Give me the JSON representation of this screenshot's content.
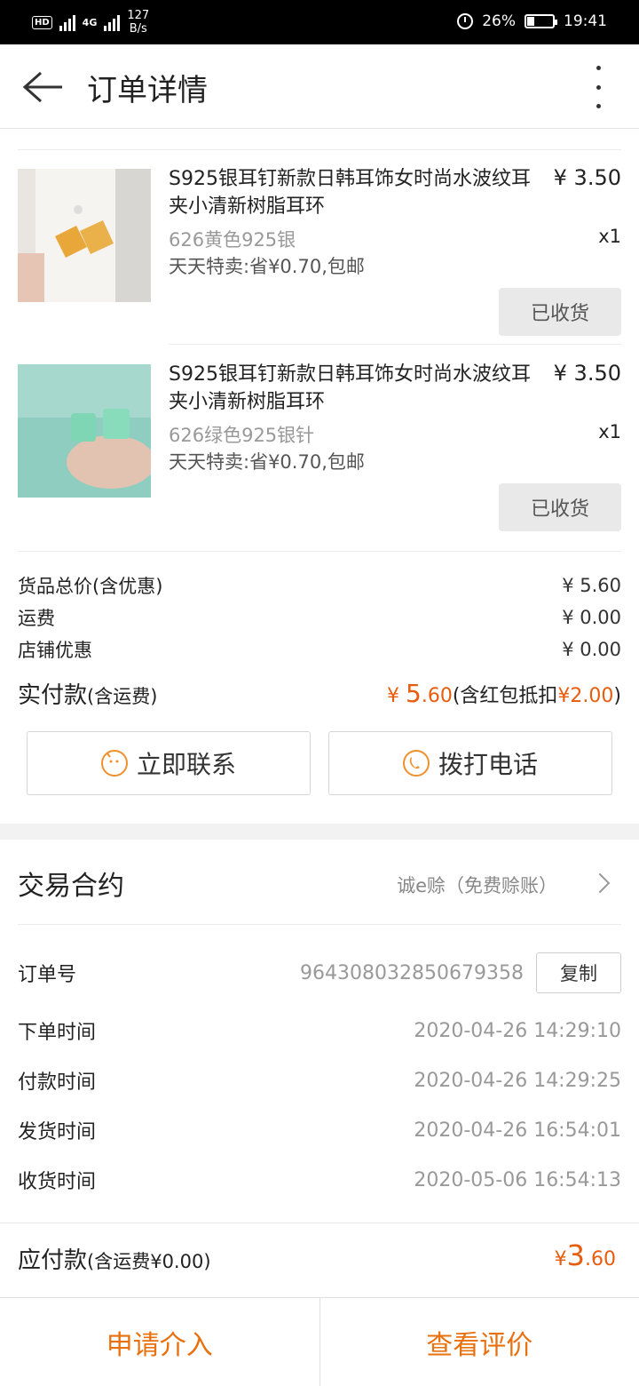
{
  "status_bar": {
    "hd": "HD",
    "network": "4G",
    "speed_value": "127",
    "speed_unit": "B/s",
    "battery_text": "26%",
    "battery_level": 0.26,
    "time": "19:41"
  },
  "header": {
    "title": "订单详情"
  },
  "products": [
    {
      "name": "S925银耳钉新款日韩耳饰女时尚水波纹耳夹小清新树脂耳环",
      "price": "¥ 3.50",
      "spec": "626黄色925银",
      "qty": "x1",
      "promo": "天天特卖:省¥0.70,包邮",
      "status_button": "已收货"
    },
    {
      "name": "S925银耳钉新款日韩耳饰女时尚水波纹耳夹小清新树脂耳环",
      "price": "¥ 3.50",
      "spec": "626绿色925银针",
      "qty": "x1",
      "promo": "天天特卖:省¥0.70,包邮",
      "status_button": "已收货"
    }
  ],
  "summary": {
    "goods_total_label": "货品总价(含优惠)",
    "goods_total_value": "¥ 5.60",
    "shipping_label": "运费",
    "shipping_value": "¥ 0.00",
    "store_discount_label": "店铺优惠",
    "store_discount_value": "¥ 0.00",
    "paid_label": "实付款",
    "paid_label_note": "(含运费)",
    "paid_currency": "¥ ",
    "paid_int": "5",
    "paid_dec": ".60",
    "paid_note_prefix": "(含红包抵扣",
    "paid_note_amount": "¥2.00",
    "paid_note_suffix": ")"
  },
  "contact": {
    "chat_label": "立即联系",
    "call_label": "拨打电话"
  },
  "contract": {
    "title": "交易合约",
    "value": "诚e赊（免费赊账）"
  },
  "order_info": {
    "order_no_label": "订单号",
    "order_no": "964308032850679358",
    "copy_label": "复制",
    "rows": [
      {
        "label": "下单时间",
        "value": "2020-04-26 14:29:10"
      },
      {
        "label": "付款时间",
        "value": "2020-04-26 14:29:25"
      },
      {
        "label": "发货时间",
        "value": "2020-04-26 16:54:01"
      },
      {
        "label": "收货时间",
        "value": "2020-05-06 16:54:13"
      }
    ]
  },
  "amount_due": {
    "label": "应付款",
    "note": "(含运费¥0.00)",
    "currency": "¥",
    "int": "3",
    "dec": ".60"
  },
  "bottom_actions": {
    "left": "申请介入",
    "right": "查看评价"
  },
  "colors": {
    "accent": "#e8700f",
    "price_orange": "#e85c0d",
    "icon_orange": "#f0902c"
  }
}
